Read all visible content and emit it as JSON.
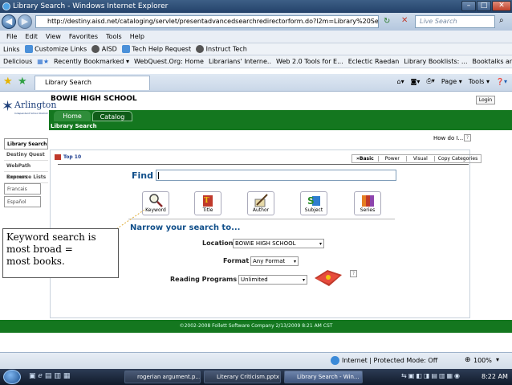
{
  "window": {
    "title": "Library Search - Windows Internet Explorer",
    "minimize": "–",
    "maximize": "□",
    "close": "✕"
  },
  "address": {
    "url": "http://destiny.aisd.net/cataloging/servlet/presentadvancedsearchredirectorform.do?l2m=Library%20Search&tm=Catalog",
    "live_search": "Live Search"
  },
  "menu": [
    "File",
    "Edit",
    "View",
    "Favorites",
    "Tools",
    "Help"
  ],
  "links_bar": [
    "Links",
    "Customize Links",
    "AISD",
    "Tech Help Request",
    "Instruct Tech"
  ],
  "delicious_bar": [
    "Delicious",
    "Recently Bookmarked ▾",
    "WebQuest.Org: Home",
    "Librarians' Interne..",
    "Web 2.0 Tools for E...",
    "Eclectic Raedan",
    "Library Booklists: ...",
    "Booktalks and \\"
  ],
  "tab": {
    "label": "Library Search",
    "tools": [
      "Page ▾",
      "Tools ▾"
    ]
  },
  "page": {
    "logo": "Arlington",
    "logo_sub": "Independent School District",
    "school": "BOWIE HIGH SCHOOL",
    "login": "Login",
    "nav_tabs": [
      "Home",
      "Catalog"
    ],
    "section_title": "Library Search",
    "how_do_i": "How do I...",
    "sidebar": [
      "Library Search",
      "Destiny Quest",
      "WebPath Express",
      "Resource Lists",
      "Francais",
      "Español"
    ],
    "top10": "Top 10",
    "search_tabs": [
      "»Basic",
      "Power",
      "Visual",
      "Copy Categories"
    ],
    "find_label": "Find",
    "find_value": "",
    "search_buttons": [
      "Keyword",
      "Title",
      "Author",
      "Subject",
      "Series"
    ],
    "narrow_title": "Narrow your search to...",
    "location_label": "Location",
    "location_value": "BOWIE HIGH SCHOOL",
    "format_label": "Format",
    "format_value": "Any Format",
    "reading_label": "Reading Programs",
    "reading_value": "Unlimited",
    "footer": "©2002-2008  Follett Software Company     2/13/2009 8:21 AM CST"
  },
  "callout": "Keyword search is\n most broad =\nmost books.",
  "status": {
    "zone": "Internet | Protected Mode: Off",
    "zoom": "100%"
  },
  "taskbar": {
    "items": [
      "rogerian argument.p...",
      "Literary Criticism.pptx",
      "Library Search - Win..."
    ],
    "clock": "8:22 AM"
  }
}
